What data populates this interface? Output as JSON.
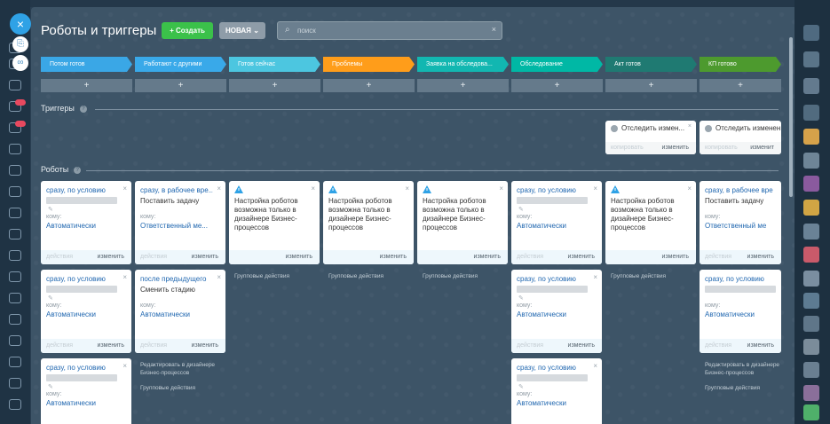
{
  "header": {
    "title": "Роботы и триггеры",
    "create_label": "Создать",
    "create_plus": "+",
    "filter_label": "НОВАЯ",
    "filter_chevron": "⌄",
    "search_placeholder": "поиск",
    "search_clear": "×"
  },
  "sidebar": {
    "close_glyph": "×"
  },
  "colors": {
    "create": "#3bc14a",
    "accent": "#2fa2e6"
  },
  "stages": [
    {
      "label": "Потом готов",
      "color": "#3aa7e6"
    },
    {
      "label": "Работают с другими",
      "color": "#39a9e9"
    },
    {
      "label": "Готов сейчас",
      "color": "#4cc6e0"
    },
    {
      "label": "Проблемы",
      "color": "#ff9d1a"
    },
    {
      "label": "Заявка на обследова...",
      "color": "#12b7b1"
    },
    {
      "label": "Обследование",
      "color": "#00b8a5"
    },
    {
      "label": "Акт готов",
      "color": "#1f7a72"
    },
    {
      "label": "КП готово",
      "color": "#4d9a2e"
    }
  ],
  "add_glyph": "+",
  "sections": {
    "triggers": "Триггеры",
    "robots": "Роботы",
    "help_glyph": "?"
  },
  "triggers": [
    {
      "title": "Отследить измен...",
      "copy": "копировать",
      "edit": "изменить"
    },
    {
      "title": "Отследить изменен",
      "copy": "копировать",
      "edit": "изменит"
    }
  ],
  "robots_common": {
    "to_label": "кому:",
    "actions_label": "действия",
    "edit_label": "изменить",
    "warn_text": "Настройка роботов возможна только в дизайнере Бизнес-процессов",
    "group_actions": "Групповые действия",
    "edit_in_designer": "Редактировать в дизайнере Бизнес-процессов",
    "close_glyph": "×",
    "pen_glyph": "✎"
  },
  "robot_cards": {
    "c0r0": {
      "cond": "сразу, по условию",
      "to": "Автоматически"
    },
    "c1r0": {
      "cond": "сразу, в рабочее вре...",
      "action": "Поставить задачу",
      "to": "Ответственный ме..."
    },
    "c1r1": {
      "cond": "после предыдущего",
      "action": "Сменить стадию",
      "to": "Автоматически"
    },
    "c0r1": {
      "cond": "сразу, по условию",
      "to": "Автоматически"
    },
    "c0r2": {
      "cond": "сразу, по условию",
      "to": "Автоматически"
    },
    "c5r0": {
      "cond": "сразу, по условию",
      "to": "Автоматически"
    },
    "c5r1": {
      "cond": "сразу, по условию",
      "to": "Автоматически"
    },
    "c5r2": {
      "cond": "сразу, по условию",
      "to": "Автоматически"
    },
    "c7r0": {
      "cond": "сразу, в рабочее вре",
      "action": "Поставить задачу",
      "to": "Ответственный ме"
    },
    "c7r1": {
      "cond": "сразу, по условию",
      "to": "Автоматически"
    }
  }
}
